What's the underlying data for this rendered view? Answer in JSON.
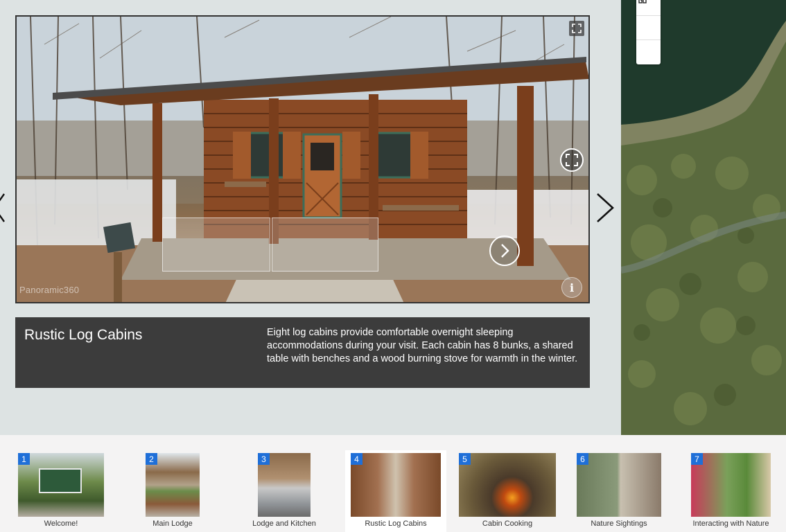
{
  "viewer": {
    "watermark": "Panoramic360",
    "info_label": "i"
  },
  "caption": {
    "title": "Rustic Log Cabins",
    "text": "Eight log cabins provide comfortable overnight sleeping accommodations during your visit. Each cabin has 8 bunks, a shared table with benches and a wood burning stove for warmth in the winter."
  },
  "map": {
    "zoom_in_icon": "plus-icon",
    "home_icon": "home-icon",
    "zoom_out_icon": "minus-icon"
  },
  "carousel": {
    "active_index": 4,
    "items": [
      {
        "number": "1",
        "label": "Welcome!"
      },
      {
        "number": "2",
        "label": "Main Lodge"
      },
      {
        "number": "3",
        "label": "Lodge and Kitchen"
      },
      {
        "number": "4",
        "label": "Rustic Log Cabins"
      },
      {
        "number": "5",
        "label": "Cabin Cooking"
      },
      {
        "number": "6",
        "label": "Nature Sightings"
      },
      {
        "number": "7",
        "label": "Interacting with Nature"
      }
    ]
  },
  "colors": {
    "badge": "#1f6fd8",
    "caption_bg": "#3c3c3c",
    "page_bg": "#dde3e3"
  }
}
